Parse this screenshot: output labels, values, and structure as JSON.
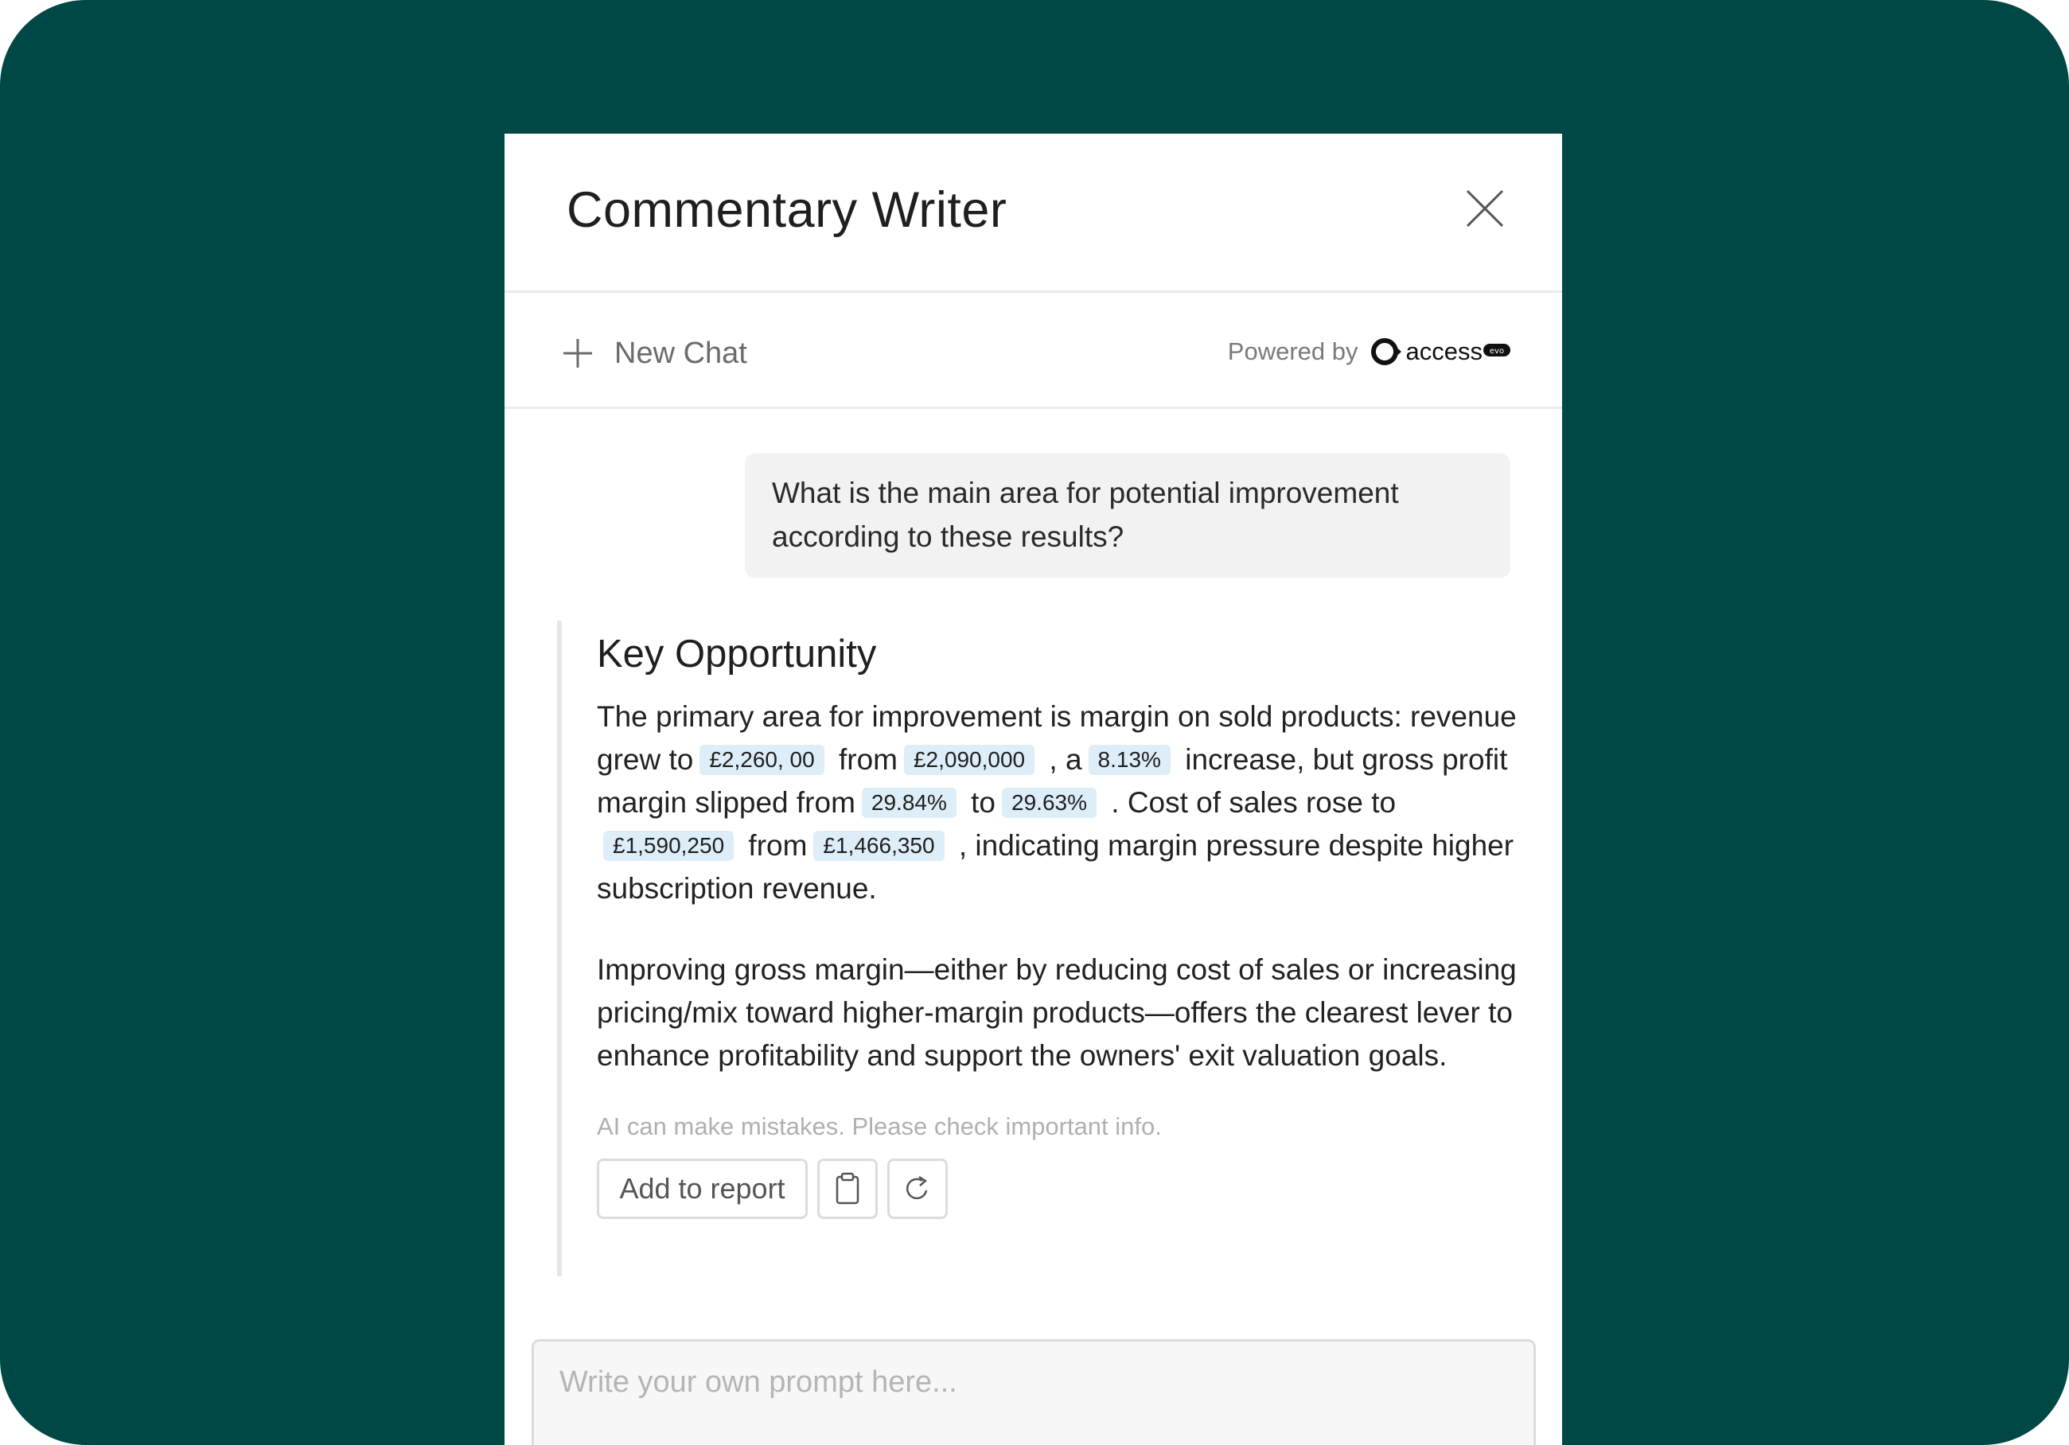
{
  "dialog": {
    "title": "Commentary Writer",
    "close_icon": "close-icon"
  },
  "toolbar": {
    "new_chat_label": "New Chat",
    "new_chat_icon": "plus-icon",
    "powered_by_label": "Powered by",
    "brand_name": "access",
    "brand_badge_text": "evo"
  },
  "conversation": {
    "user_message": "What is the main area for potential improvement according to these results?",
    "reply": {
      "heading": "Key Opportunity",
      "p1": {
        "t1": "The primary area for improvement is margin on sold products: revenue grew to",
        "c1": "£2,260, 00",
        "t2": "from",
        "c2": "£2,090,000",
        "t3": ", a",
        "c3": "8.13%",
        "t4": "increase, but gross profit margin slipped from",
        "c4": "29.84%",
        "t5": "to",
        "c5": "29.63%",
        "t6": ". Cost of sales rose to",
        "c6": "£1,590,250",
        "t7": "from",
        "c7": "£1,466,350",
        "t8": ", indicating margin pressure despite higher subscription revenue."
      },
      "p2": "Improving gross margin—either by reducing cost of sales or increasing pricing/mix toward higher-margin products—offers the clearest lever to enhance profitability and support the owners' exit valuation goals.",
      "disclaimer": "AI can make mistakes. Please check important info.",
      "add_to_report_label": "Add to report",
      "copy_icon": "clipboard-icon",
      "regenerate_icon": "refresh-icon"
    }
  },
  "prompt": {
    "placeholder": "Write your own prompt here..."
  },
  "colors": {
    "background": "#004845",
    "chip": "#ddeef8"
  }
}
